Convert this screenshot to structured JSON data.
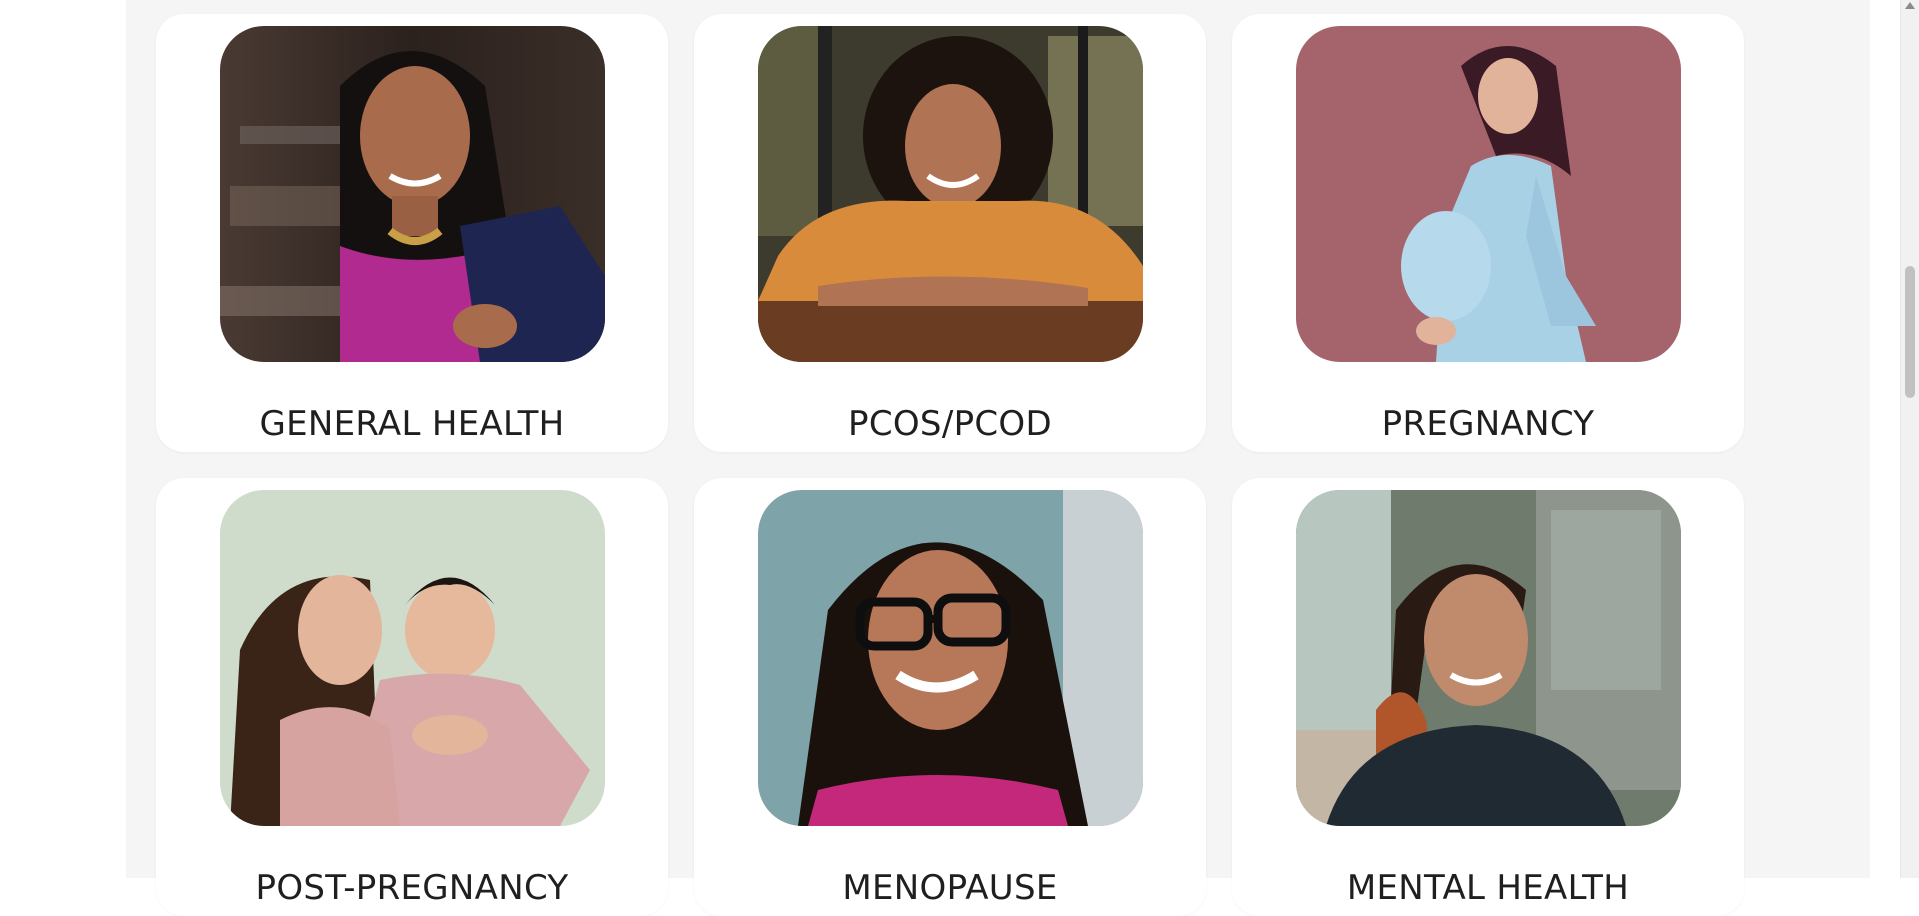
{
  "categories": [
    {
      "label": "GENERAL HEALTH",
      "image_icon": "woman-in-saree-photo"
    },
    {
      "label": "PCOS/PCOD",
      "image_icon": "woman-curly-hair-cafe-photo"
    },
    {
      "label": "PREGNANCY",
      "image_icon": "pregnant-woman-photo"
    },
    {
      "label": "POST-PREGNANCY",
      "image_icon": "mother-with-baby-photo"
    },
    {
      "label": "MENOPAUSE",
      "image_icon": "woman-with-glasses-photo"
    },
    {
      "label": "MENTAL HEALTH",
      "image_icon": "smiling-woman-home-photo"
    }
  ],
  "colors": {
    "card_bg": "#ffffff",
    "page_bg": "#f4f5f4",
    "label_text": "#1f1f1f",
    "pregnancy_photo_bg": "#a5636c",
    "post_pregnancy_photo_bg": "#cfdccb"
  }
}
